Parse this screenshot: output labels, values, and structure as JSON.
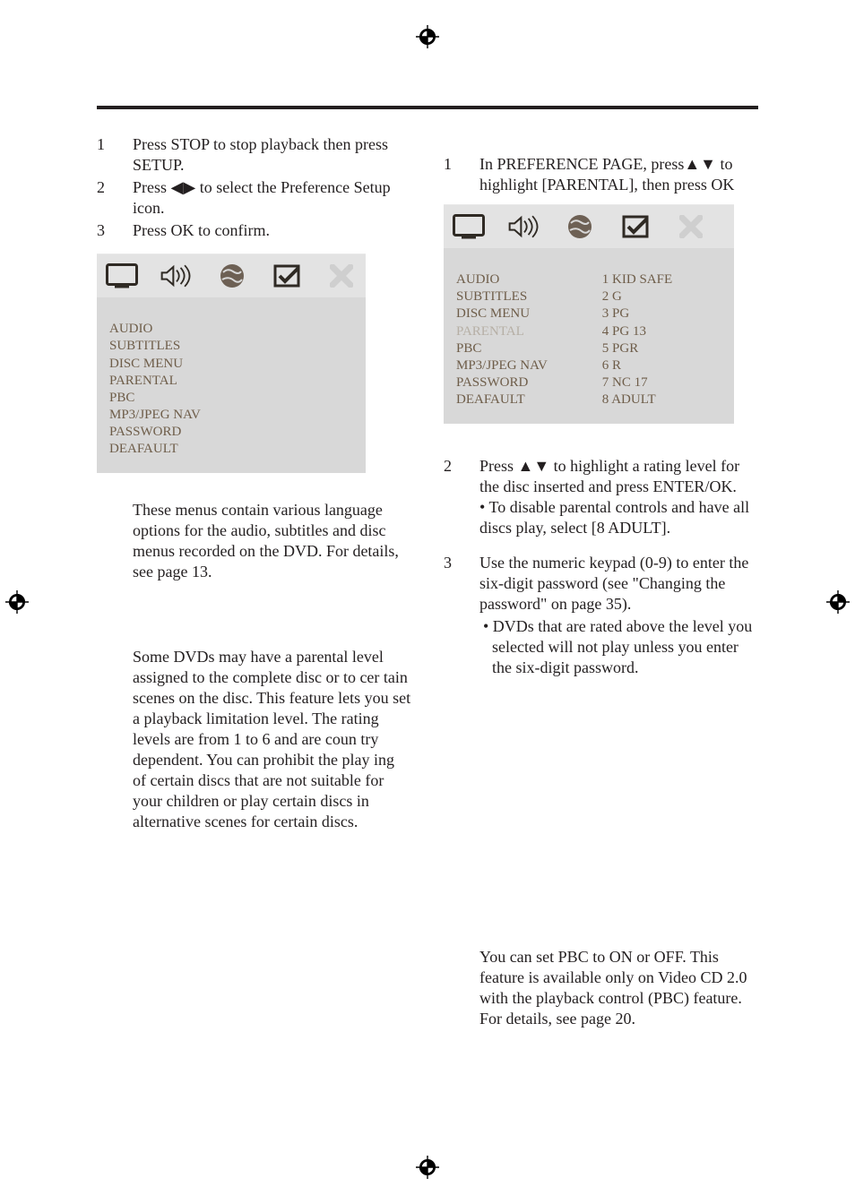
{
  "left": {
    "steps": [
      {
        "num": "1",
        "text": "Press STOP  to stop playback then press SETUP."
      },
      {
        "num": "2",
        "text": "Press ◀▶ to select the Preference Setup icon."
      },
      {
        "num": "3",
        "text": "Press OK to confirm."
      }
    ],
    "osd_items": [
      "AUDIO",
      "SUBTITLES",
      "DISC MENU",
      "PARENTAL",
      "PBC",
      "MP3/JPEG NAV",
      "PASSWORD",
      "DEAFAULT"
    ],
    "para_lang": "These menus contain various language options for the audio, subtitles and disc menus recorded on the DVD. For details, see page 13.",
    "para_parental": "Some DVDs may have a parental level assigned to the complete disc or to cer tain   scenes on the disc. This feature lets you set a playback limitation level. The rating levels are from 1 to 6 and are coun try dependent. You can prohibit the play ing of certain discs that are not suitable for your children or play certain discs in alternative scenes for certain discs."
  },
  "right": {
    "step1": {
      "num": "1",
      "text": "In PREFERENCE PAGE, press▲▼ to highlight [PARENTAL], then press OK"
    },
    "osd_left": [
      "AUDIO",
      "SUBTITLES",
      "DISC MENU",
      "PARENTAL",
      "PBC",
      "MP3/JPEG NAV",
      "PASSWORD",
      "DEAFAULT"
    ],
    "osd_left_highlight_index": 3,
    "osd_right": [
      "1 KID SAFE",
      "2 G",
      "3 PG",
      "4 PG 13",
      "5 PGR",
      "6 R",
      "7 NC 17",
      "8 ADULT"
    ],
    "step2": {
      "num": "2",
      "text": "Press ▲▼ to highlight a rating level for the disc inserted and press ENTER/OK.",
      "bullet": "• To disable parental controls and have all discs play, select [8 ADULT]."
    },
    "step3": {
      "num": "3",
      "text": "Use the numeric keypad (0-9) to enter the six-digit password (see \"Changing the password\" on page 35).",
      "bullet": "• DVDs that are rated above the level you selected will not play unless you enter the six-digit password."
    },
    "para_pbc": "You can set PBC to ON or OFF. This feature is available only on Video CD 2.0 with the playback control (PBC) feature. For details, see page 20."
  }
}
